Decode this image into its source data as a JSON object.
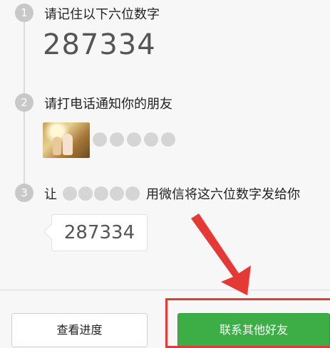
{
  "steps": [
    {
      "number": "1",
      "title": "请记住以下六位数字"
    },
    {
      "number": "2",
      "title": "请打电话通知你的朋友"
    },
    {
      "number": "3",
      "title_prefix": "让",
      "title_suffix": "用微信将这六位数字发给你"
    }
  ],
  "code": "287334",
  "buttons": {
    "view_progress": "查看进度",
    "contact_other_friend": "联系其他好友"
  },
  "colors": {
    "accent_green": "#3cae45",
    "annotation_red": "#e53935",
    "step_circle": "#c8c8c8"
  },
  "icons": {
    "friend_avatar": "friend-photo",
    "annotation_arrow": "red-arrow"
  }
}
